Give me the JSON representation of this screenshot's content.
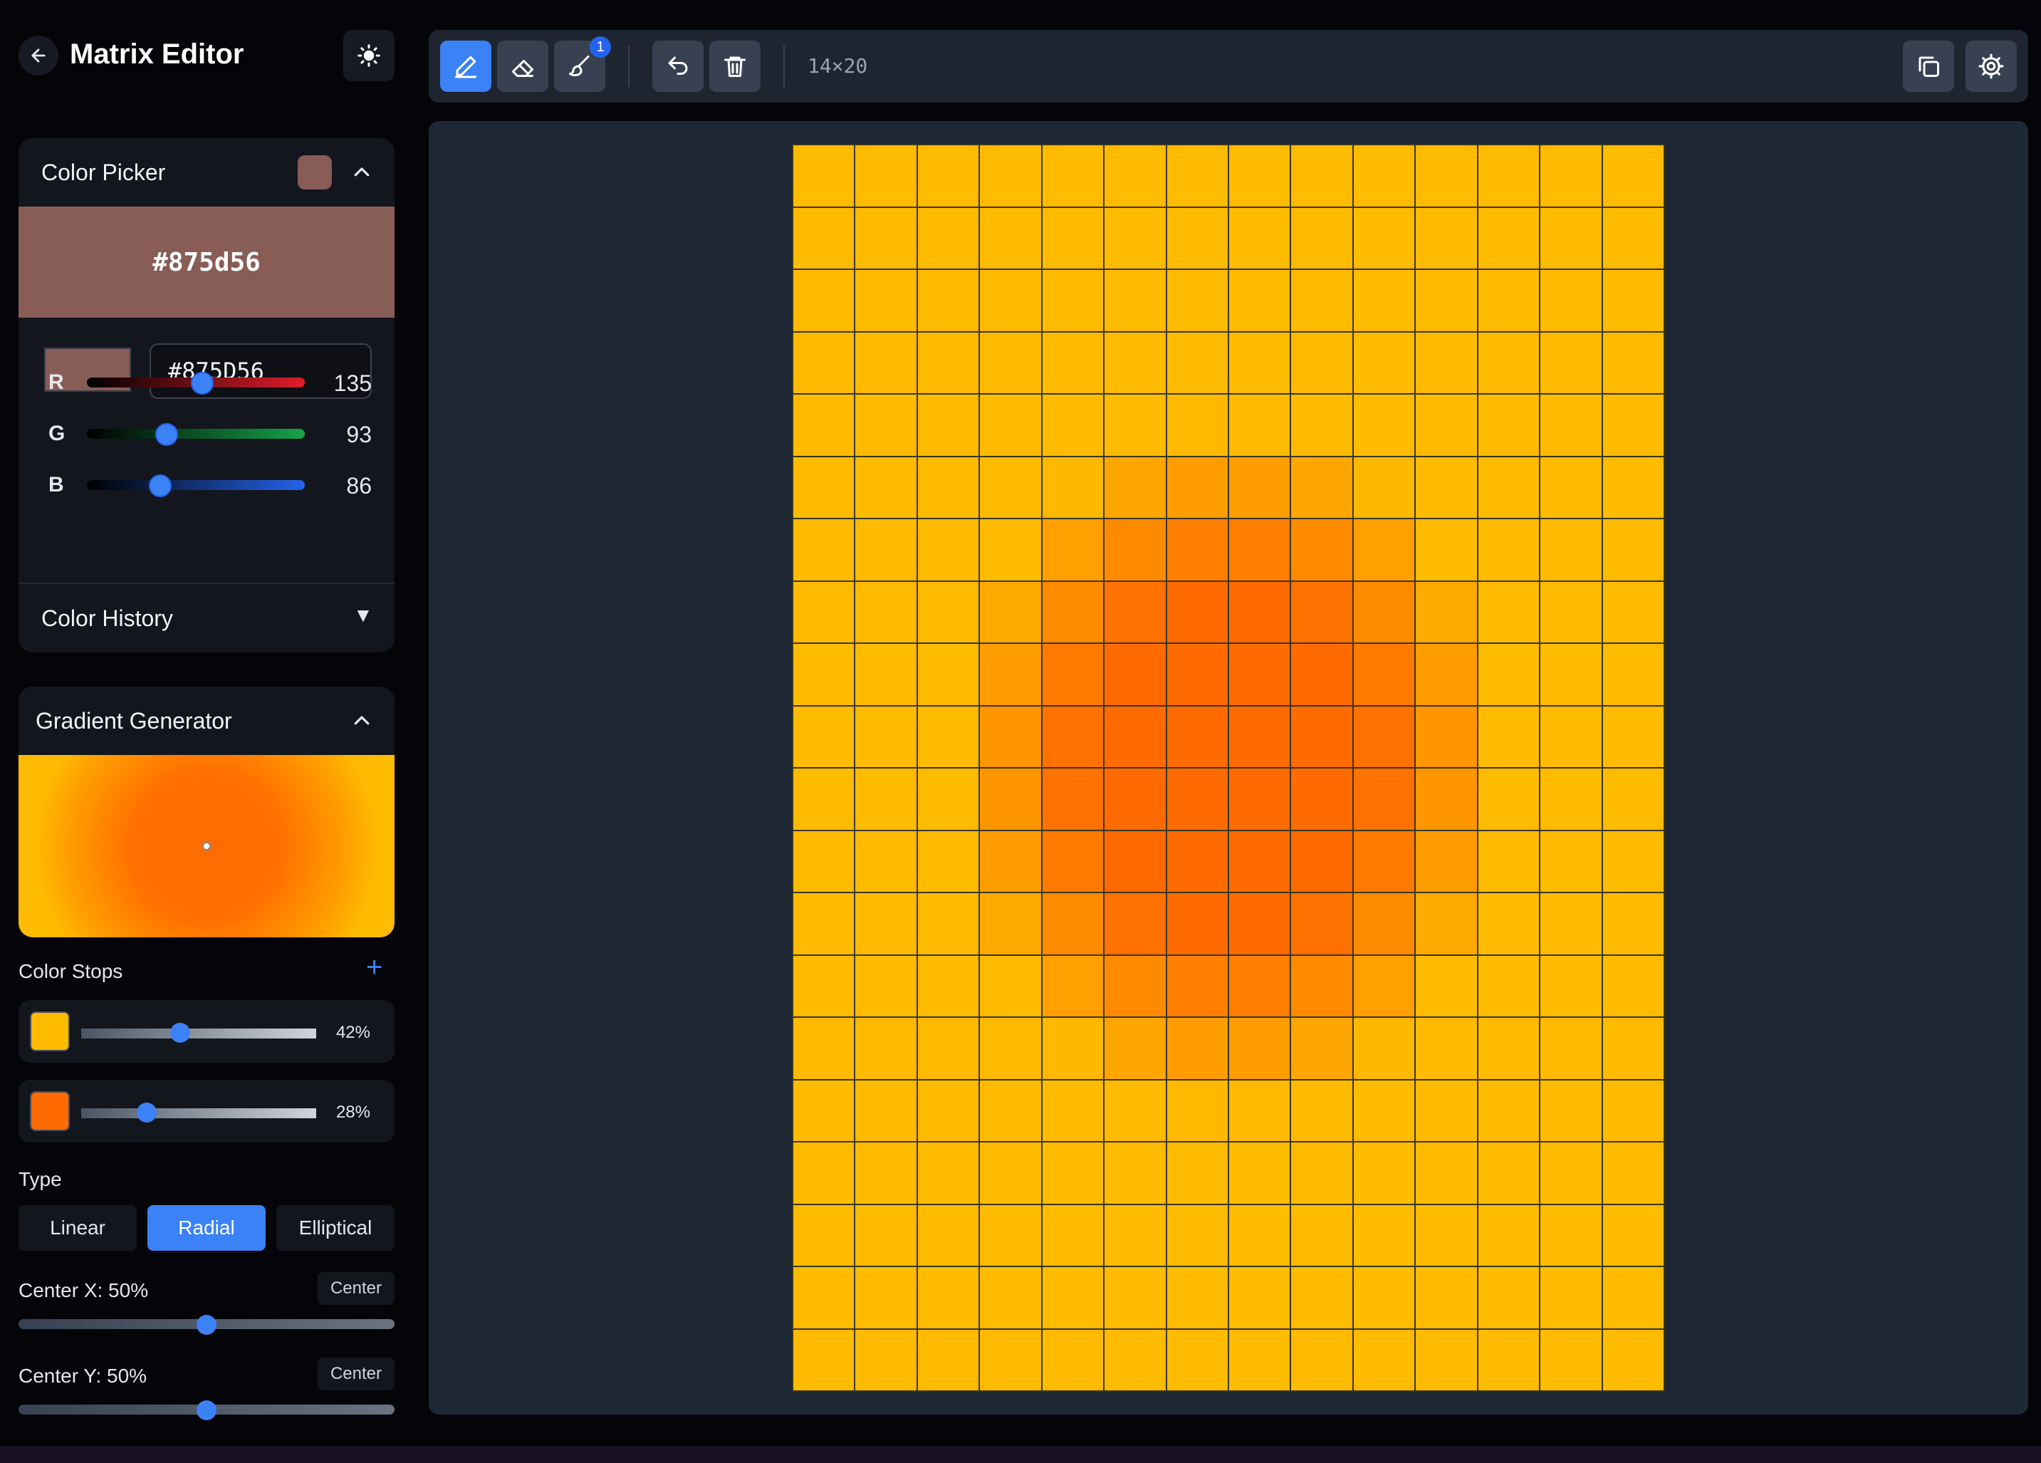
{
  "app": {
    "title": "Matrix Editor"
  },
  "icons": {
    "back": "arrow-left-icon",
    "theme": "sun-icon",
    "pencil": "pencil-icon",
    "eraser": "eraser-icon",
    "brush": "brush-icon",
    "undo": "undo-icon",
    "delete": "trash-icon",
    "copy": "copy-icon",
    "settings": "gear-icon"
  },
  "color_picker": {
    "title": "Color Picker",
    "current_hex_display": "#875d56",
    "hex_input_value": "#875D56",
    "color": "#875d56",
    "channels": [
      {
        "label": "R",
        "value": "135",
        "fraction": 0.529
      },
      {
        "label": "G",
        "value": "93",
        "fraction": 0.365
      },
      {
        "label": "B",
        "value": "86",
        "fraction": 0.337
      }
    ],
    "history_title": "Color History",
    "history_caret": "▼"
  },
  "gradient": {
    "title": "Gradient Generator",
    "stops_label": "Color Stops",
    "add_label": "+",
    "stops": [
      {
        "color": "#ffbb00",
        "value": "42%",
        "fraction": 0.42
      },
      {
        "color": "#ff6b00",
        "value": "28%",
        "fraction": 0.28
      }
    ],
    "type_label": "Type",
    "types": [
      {
        "label": "Linear",
        "active": false
      },
      {
        "label": "Radial",
        "active": true
      },
      {
        "label": "Elliptical",
        "active": false
      }
    ],
    "center_x": {
      "label": "Center X: 50%",
      "button": "Center",
      "fraction": 0.5
    },
    "center_y": {
      "label": "Center Y: 50%",
      "button": "Center",
      "fraction": 0.5
    }
  },
  "toolbar": {
    "brush_badge": "1",
    "dimensions": "14×20"
  },
  "matrix": {
    "cols": 14,
    "rows": 20,
    "center_color": "#ff6b00",
    "edge_color": "#ffbb00"
  }
}
